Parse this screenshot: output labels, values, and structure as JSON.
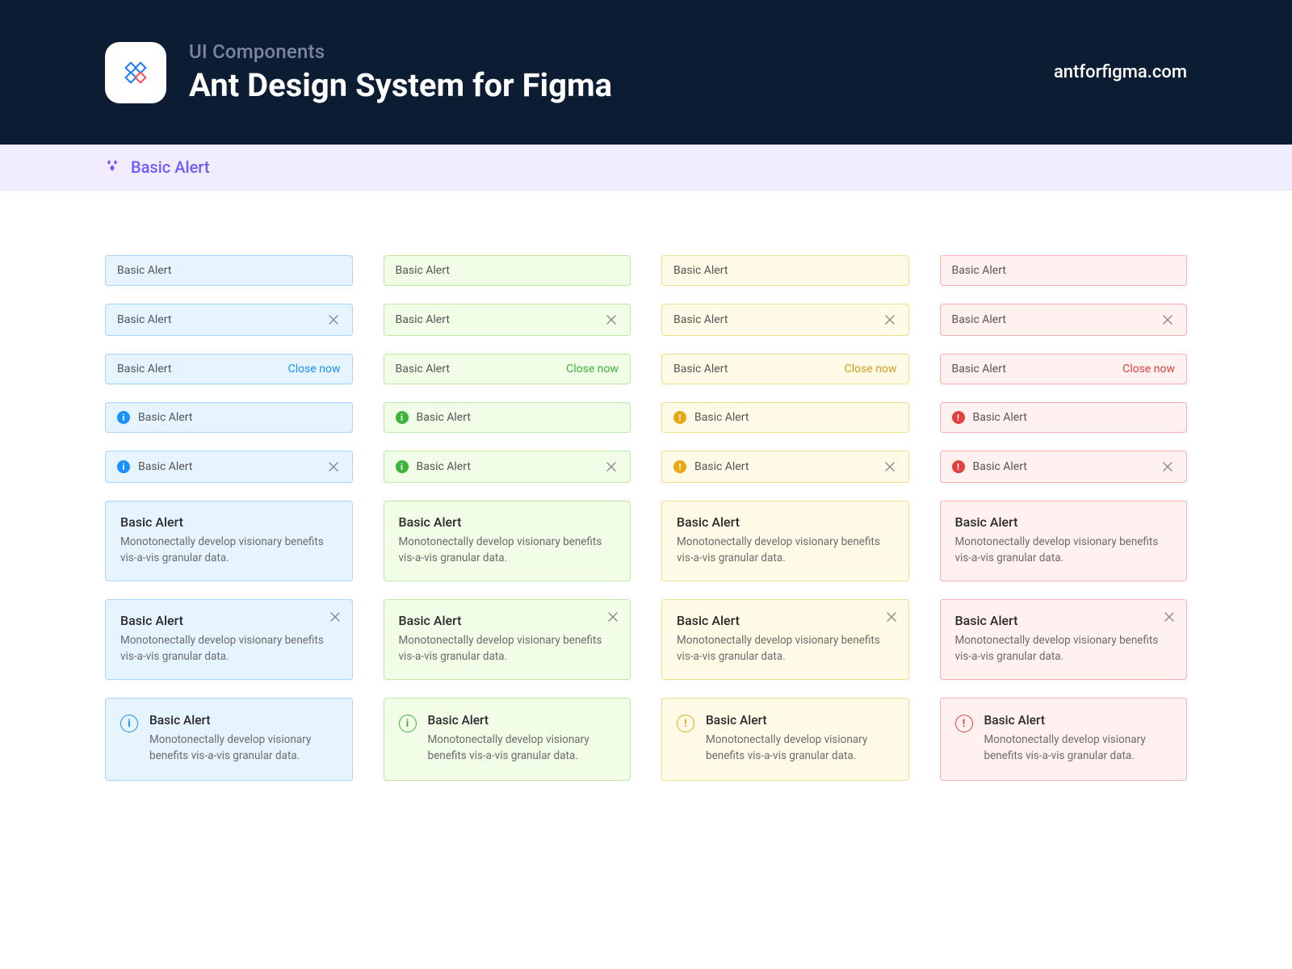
{
  "header": {
    "eyebrow": "UI Components",
    "title": "Ant Design System for Figma",
    "link": "antforfigma.com"
  },
  "ribbon": {
    "label": "Basic Alert"
  },
  "labels": {
    "basic": "Basic Alert",
    "close_now": "Close now",
    "desc": "Monotonectally develop visionary benefits vis-a-vis granular data."
  },
  "colors": {
    "info": {
      "bg": "#e6f4ff",
      "border": "#a7d3ff",
      "accent": "#1890ff"
    },
    "success": {
      "bg": "#f2fde8",
      "border": "#bfe8a3",
      "accent": "#3cb43c"
    },
    "warning": {
      "bg": "#fffbe6",
      "border": "#f2dd8e",
      "accent": "#d89b1e"
    },
    "error": {
      "bg": "#fff1f0",
      "border": "#f3b2af",
      "accent": "#e0423f"
    }
  },
  "variants": [
    "info",
    "success",
    "warning",
    "error"
  ],
  "rows": [
    {
      "kind": "plain"
    },
    {
      "kind": "closable_x"
    },
    {
      "kind": "closable_text"
    },
    {
      "kind": "icon"
    },
    {
      "kind": "icon_closable_x"
    },
    {
      "kind": "description"
    },
    {
      "kind": "description_closable_x"
    },
    {
      "kind": "big_icon_description"
    }
  ],
  "icon_glyph": {
    "info": "i",
    "success": "i",
    "warning": "!",
    "error": "!"
  }
}
